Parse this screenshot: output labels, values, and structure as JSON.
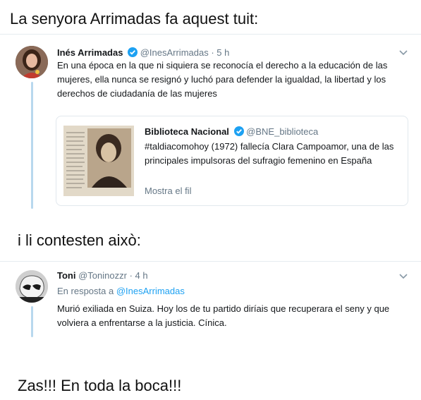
{
  "captions": {
    "top": "La senyora Arrimadas fa aquest tuit:",
    "middle": "i li contesten això:",
    "bottom": "Zas!!! En toda la boca!!!"
  },
  "tweet1": {
    "name": "Inés Arrimadas",
    "handle": "@InesArrimadas",
    "time": "· 5 h",
    "text": "En una época en la que ni siquiera se reconocía el derecho a la educación de las mujeres, ella nunca se resignó y luchó para defender la igualdad, la libertad y los derechos de ciudadanía de las mujeres"
  },
  "quote": {
    "name": "Biblioteca Nacional",
    "handle": "@BNE_biblioteca",
    "text": "#taldiacomohoy (1972) fallecía Clara Campoamor, una de las principales impulsoras del sufragio femenino en España",
    "show_thread": "Mostra el fil"
  },
  "tweet2": {
    "name": "Toni",
    "handle": "@Toninozzr",
    "time": "· 4 h",
    "reply_prefix": "En resposta a",
    "reply_to": "@InesArrimadas",
    "text": "Murió exiliada en Suiza. Hoy los de tu partido diríais que recuperara el seny y que volviera a enfrentarse a la justicia. Cínica."
  },
  "colors": {
    "verified": "#1da1f2",
    "link": "#1da1f2",
    "thread_line": "#b8d8ee",
    "muted": "#657786"
  }
}
